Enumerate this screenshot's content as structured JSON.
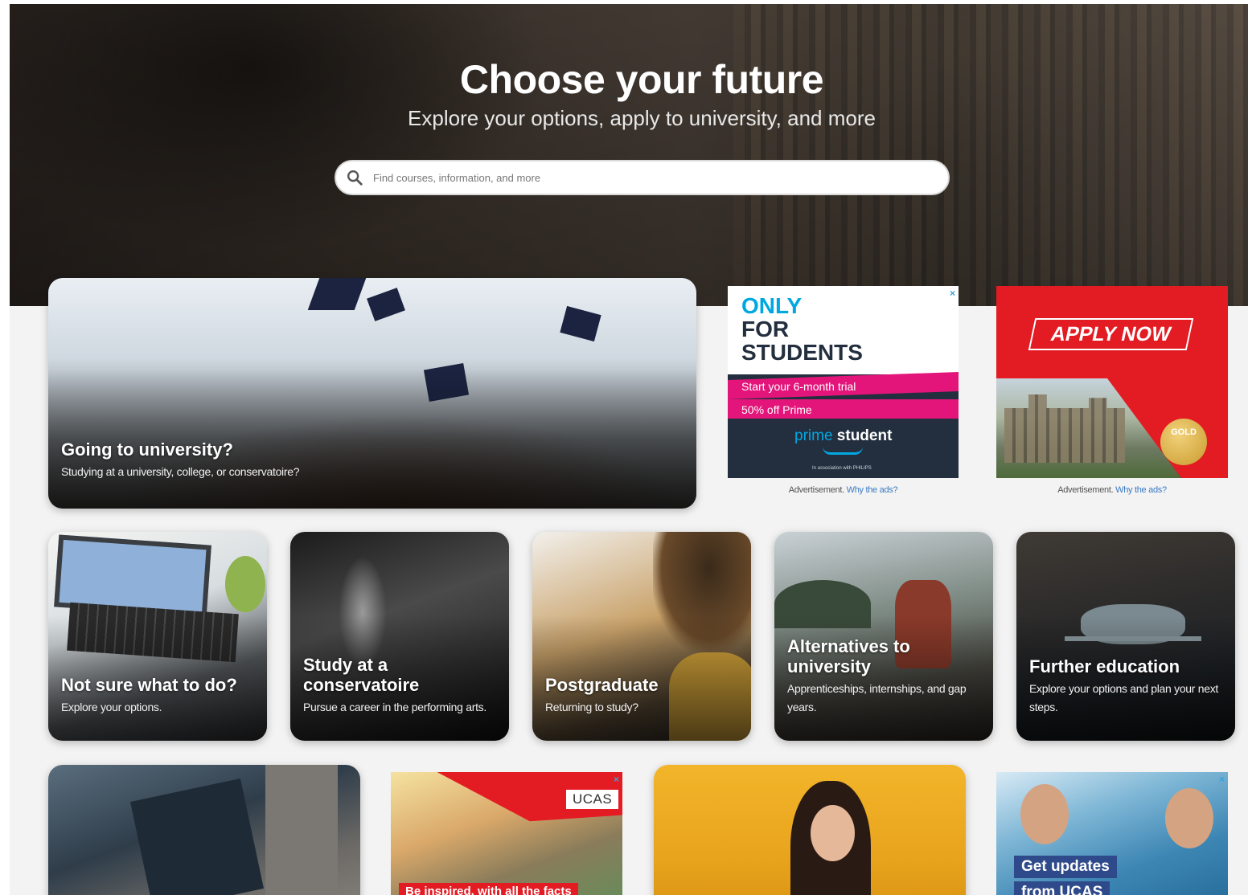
{
  "hero": {
    "title": "Choose your future",
    "subtitle": "Explore your options, apply to university, and more",
    "search_placeholder": "Find courses, information, and more"
  },
  "cards": [
    {
      "title": "Going to university?",
      "desc": "Studying at a university, college, or conservatoire?"
    },
    {
      "title": "Not sure what to do?",
      "desc": "Explore your options."
    },
    {
      "title": "Study at a conservatoire",
      "desc": "Pursue a career in the performing arts."
    },
    {
      "title": "Postgraduate",
      "desc": "Returning to study?"
    },
    {
      "title": "Alternatives to university",
      "desc": "Apprenticeships, internships, and gap years."
    },
    {
      "title": "Further education",
      "desc": "Explore your options and plan your next steps."
    }
  ],
  "ads": {
    "prime": {
      "line1": "ONLY",
      "line2": "FOR",
      "line3": "STUDENTS",
      "trial": "Start your 6-month trial",
      "offer": "50% off Prime",
      "brand_prime": "prime",
      "brand_student": "student",
      "assoc": "In association with PHILIPS"
    },
    "apply": {
      "cta": "APPLY NOW",
      "badge": "GOLD"
    },
    "ucas": {
      "logo": "UCAS",
      "headline": "Be inspired, with all the facts"
    },
    "updates": {
      "line1": "Get updates",
      "line2": "from UCAS"
    },
    "caption_text": "Advertisement.",
    "caption_link": "Why the ads?",
    "close": "×"
  },
  "colors": {
    "prime_blue": "#00a8e1",
    "prime_pink": "#e3157a",
    "prime_navy": "#232f3e",
    "ucas_red": "#e31b23",
    "link": "#3a7ac3"
  }
}
